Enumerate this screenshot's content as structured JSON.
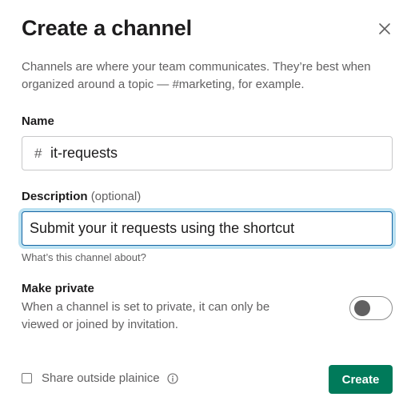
{
  "dialog": {
    "title": "Create a channel",
    "close_icon": "close-icon",
    "intro_lines": [
      "Channels are where your team communicates. They’re best when",
      "organized around a topic — #marketing, for example."
    ]
  },
  "name_field": {
    "label": "Name",
    "prefix": "#",
    "value": "it-requests"
  },
  "description_field": {
    "label": "Description",
    "optional_label": "(optional)",
    "value": "Submit your it requests using the shortcut",
    "hint": "What’s this channel about?",
    "focused": true
  },
  "private": {
    "label": "Make private",
    "description_lines": [
      "When a channel is set to private, it can only be",
      "viewed or joined by invitation."
    ],
    "enabled": false
  },
  "footer": {
    "share_label": "Share outside plainice",
    "share_checked": false,
    "info_icon": "info-icon",
    "create_label": "Create"
  },
  "colors": {
    "primary_button": "#007a5a",
    "focus_ring": "#1d9bd1",
    "text": "#1d1c1d",
    "muted_text": "#616061"
  }
}
